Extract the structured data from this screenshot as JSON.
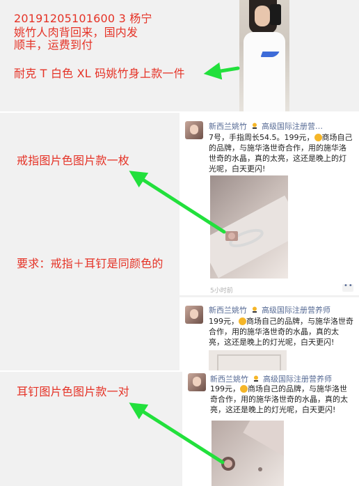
{
  "panel1": {
    "note_line1": "20191205101600 3   杨宁",
    "note_lines": "姚竹人肉背回来，国内发\n顺丰，运费到付",
    "item_note": "耐克 T 白色 XL 码姚竹身上款一件"
  },
  "panel2": {
    "ring_note": "戒指图片色图片款一枚",
    "requirement": "要求：戒指＋耳钉是同颜色的",
    "post1": {
      "username": "新西兰姚竹",
      "tag": "高级国际注册营…",
      "text_a": "7号，手指周长54.5。199元，",
      "text_b": "商场自己的品牌，与施华洛世奇合作，用的施华洛世奇的水晶，真的太亮，这还是晚上的灯光呢，白天更闪!",
      "time": "5小时前"
    },
    "post2": {
      "username": "新西兰姚竹",
      "tag": "高级国际注册营养师",
      "text_a": "199元，",
      "text_b": "商场自己的品牌，与施华洛世奇合作，用的施华洛世奇的水晶，真的太亮，这还是晚上的灯光呢，白天更闪!"
    }
  },
  "panel3": {
    "earring_note": "耳钉图片色图片款一对",
    "post3": {
      "username": "新西兰姚竹",
      "tag": "高级国际注册营养师",
      "text_a": "199元，",
      "text_b": "商场自己的品牌，与施华洛世奇合作，用的施华洛世奇的水晶，真的太亮，这还是晚上的灯光呢，白天更闪!"
    }
  },
  "colors": {
    "note_red": "#e53226",
    "arrow_green": "#22e03c",
    "link_blue": "#576b95"
  },
  "icons": [
    "green-arrow-icon",
    "badge-icon",
    "emoji-icon",
    "more-icon"
  ]
}
